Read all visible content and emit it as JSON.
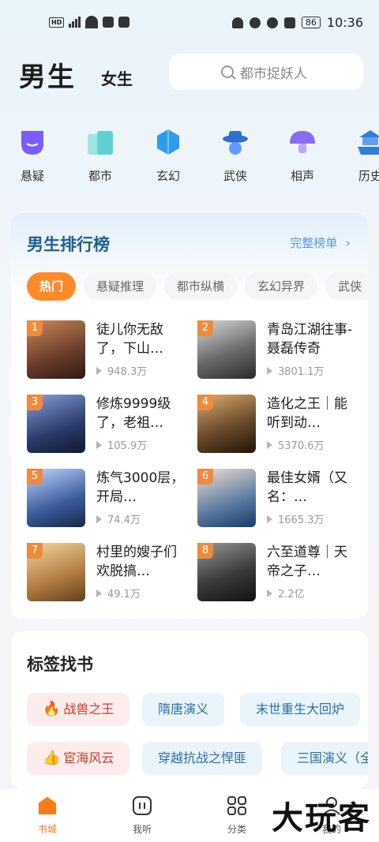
{
  "status_bar": {
    "time": "10:36",
    "battery": "86"
  },
  "header": {
    "tab_male": "男生",
    "tab_female": "女生",
    "search_placeholder": "都市捉妖人"
  },
  "categories": [
    {
      "label": "悬疑",
      "icon": "mask-icon",
      "color": "#7b5cff"
    },
    {
      "label": "都市",
      "icon": "city-icon",
      "color": "#5fd0d0"
    },
    {
      "label": "玄幻",
      "icon": "crystal-icon",
      "color": "#2f9bf0"
    },
    {
      "label": "武侠",
      "icon": "swordsman-hat-icon",
      "color": "#2f6fd0"
    },
    {
      "label": "相声",
      "icon": "mushroom-icon",
      "color": "#8a6cf0"
    },
    {
      "label": "历史",
      "icon": "pagoda-icon",
      "color": "#2f7fd8"
    }
  ],
  "ranking": {
    "title": "男生排行榜",
    "more": "完整榜单",
    "chips": [
      "热门",
      "悬疑推理",
      "都市纵横",
      "玄幻异界",
      "武侠"
    ],
    "books": [
      {
        "rank": "1",
        "title": "徒儿你无敌了，下山…",
        "count": "948.3万",
        "cover": "#6a3a2a"
      },
      {
        "rank": "2",
        "title": "青岛江湖往事-聂磊传奇",
        "count": "3801.1万",
        "cover": "#4a4a4a"
      },
      {
        "rank": "3",
        "title": "修炼9999级了，老祖…",
        "count": "105.9万",
        "cover": "#2a3a6a"
      },
      {
        "rank": "4",
        "title": "造化之王｜能听到动…",
        "count": "5370.6万",
        "cover": "#6a4a2a"
      },
      {
        "rank": "5",
        "title": "炼气3000层，开局…",
        "count": "74.4万",
        "cover": "#3a5a9a"
      },
      {
        "rank": "6",
        "title": "最佳女婿（又名：…",
        "count": "1665.3万",
        "cover": "#5a7aa0"
      },
      {
        "rank": "7",
        "title": "村里的嫂子们欢脱搞…",
        "count": "49.1万",
        "cover": "#b07a40"
      },
      {
        "rank": "8",
        "title": "六至道尊｜天帝之子…",
        "count": "2.2亿",
        "cover": "#3a3a3a"
      }
    ]
  },
  "tags": {
    "title": "标签找书",
    "row1": [
      {
        "label": "战兽之王",
        "emoji": "🔥",
        "style": "hot"
      },
      {
        "label": "隋唐演义",
        "style": "blue"
      },
      {
        "label": "末世重生大回炉",
        "style": "blue"
      }
    ],
    "row2": [
      {
        "label": "宦海风云",
        "emoji": "👍",
        "style": "hot"
      },
      {
        "label": "穿越抗战之悍匪",
        "style": "blue"
      },
      {
        "label": "三国演义（全",
        "style": "blue"
      }
    ]
  },
  "bottom_nav": [
    {
      "label": "书城",
      "icon": "bookstore-icon",
      "active": true
    },
    {
      "label": "我听",
      "icon": "listen-icon",
      "active": false
    },
    {
      "label": "分类",
      "icon": "category-grid-icon",
      "active": false
    },
    {
      "label": "我的",
      "icon": "profile-icon",
      "active": false
    }
  ],
  "watermark": "大玩客",
  "colors": {
    "accent": "#ff8a2a",
    "rank_title": "#1f5f8f",
    "link": "#5a9ad0"
  }
}
